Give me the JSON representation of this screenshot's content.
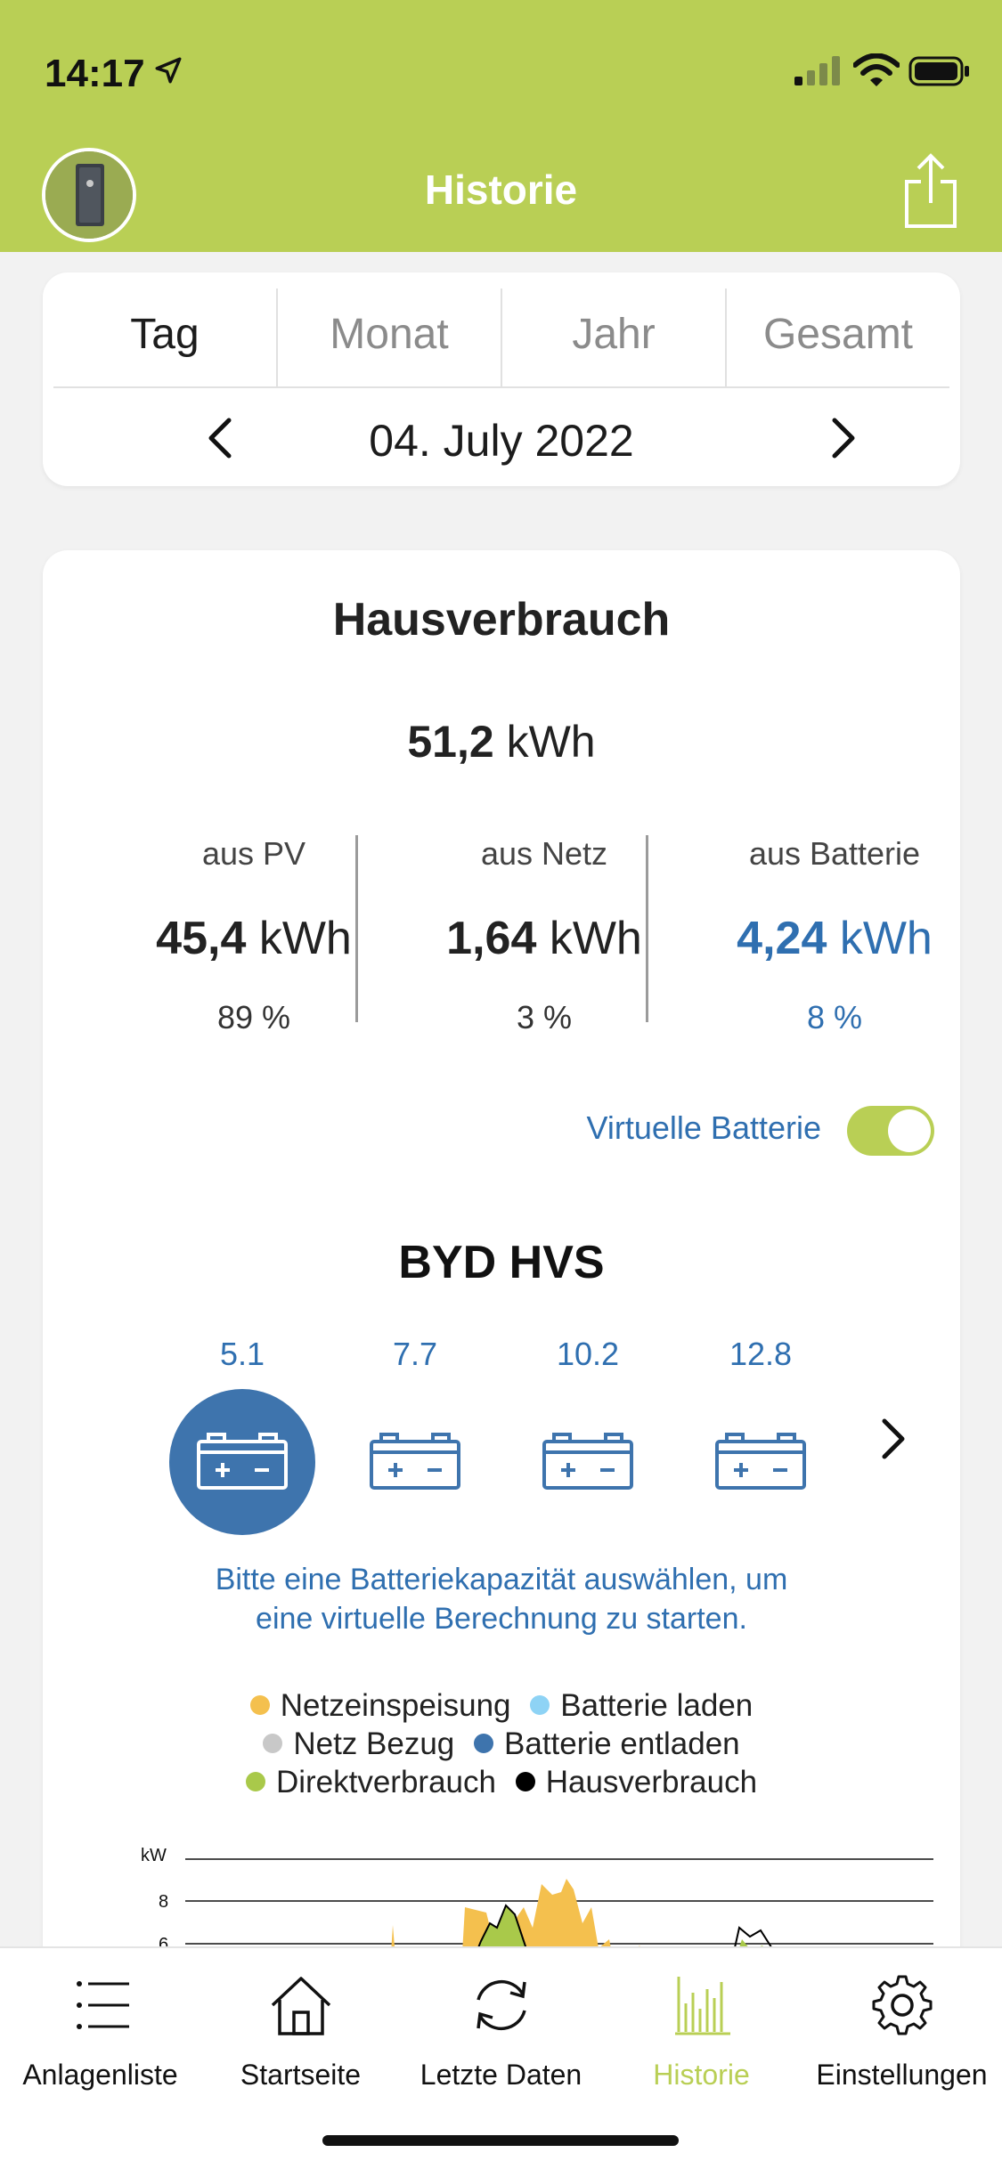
{
  "status": {
    "time": "14:17"
  },
  "header": {
    "title": "Historie"
  },
  "period": {
    "tabs": [
      {
        "label": "Tag",
        "active": true
      },
      {
        "label": "Monat",
        "active": false
      },
      {
        "label": "Jahr",
        "active": false
      },
      {
        "label": "Gesamt",
        "active": false
      }
    ],
    "date": "04. July 2022"
  },
  "consumption": {
    "title": "Hausverbrauch",
    "total_value": "51,2",
    "unit": "kWh",
    "sources": [
      {
        "label": "aus PV",
        "value": "45,4",
        "unit": "kWh",
        "percent": "89 %"
      },
      {
        "label": "aus Netz",
        "value": "1,64",
        "unit": "kWh",
        "percent": "3 %"
      },
      {
        "label": "aus Batterie",
        "value": "4,24",
        "unit": "kWh",
        "percent": "8 %"
      }
    ]
  },
  "virtual_battery": {
    "label": "Virtuelle Batterie",
    "enabled": true
  },
  "battery": {
    "title": "BYD HVS",
    "capacities": [
      "5.1",
      "7.7",
      "10.2",
      "12.8"
    ],
    "selected_index": 0,
    "hint_line1": "Bitte eine Batteriekapazität auswählen, um",
    "hint_line2": "eine virtuelle Berechnung zu starten."
  },
  "legend": [
    {
      "label": "Netzeinspeisung",
      "color": "#f4c04e"
    },
    {
      "label": "Batterie laden",
      "color": "#8ed3f5"
    },
    {
      "label": "Netz Bezug",
      "color": "#c8c8c8"
    },
    {
      "label": "Batterie entladen",
      "color": "#3e74ad"
    },
    {
      "label": "Direktverbrauch",
      "color": "#a9c94a"
    },
    {
      "label": "Hausverbrauch",
      "color": "#000000"
    }
  ],
  "chart_data": {
    "type": "area",
    "ylabel": "kW",
    "ytick_labels": [
      "8",
      "6"
    ],
    "grid": true
  },
  "tabbar": [
    {
      "label": "Anlagenliste",
      "icon": "list-icon",
      "active": false
    },
    {
      "label": "Startseite",
      "icon": "home-icon",
      "active": false
    },
    {
      "label": "Letzte Daten",
      "icon": "refresh-icon",
      "active": false
    },
    {
      "label": "Historie",
      "icon": "bar-chart-icon",
      "active": true
    },
    {
      "label": "Einstellungen",
      "icon": "gear-icon",
      "active": false
    }
  ],
  "colors": {
    "header": "#b9cf55",
    "accent_blue": "#2f6fb0",
    "selected_battery": "#3e74ad"
  }
}
